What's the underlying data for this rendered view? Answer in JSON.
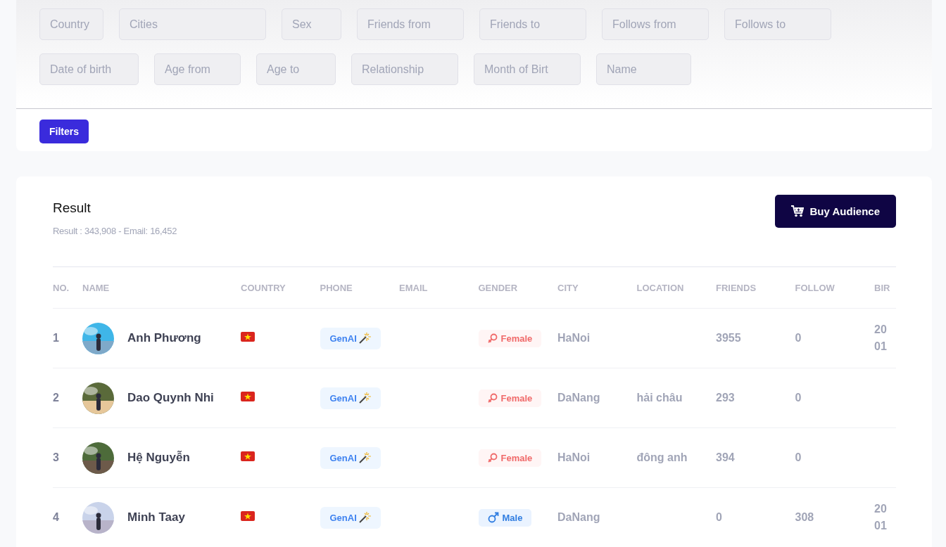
{
  "filters": {
    "fields": [
      {
        "placeholder": "Country"
      },
      {
        "placeholder": "Cities"
      },
      {
        "placeholder": "Sex"
      },
      {
        "placeholder": "Friends from"
      },
      {
        "placeholder": "Friends to"
      },
      {
        "placeholder": "Follows from"
      },
      {
        "placeholder": "Follows to"
      },
      {
        "placeholder": "Date of birth"
      },
      {
        "placeholder": "Age from"
      },
      {
        "placeholder": "Age to"
      },
      {
        "placeholder": "Relationship"
      },
      {
        "placeholder": "Month of Birt"
      },
      {
        "placeholder": "Name"
      }
    ],
    "button": "Filters"
  },
  "result": {
    "title": "Result",
    "summary": "Result : 343,908 - Email: 16,452",
    "buy_button": "Buy Audience",
    "table": {
      "columns": [
        "NO.",
        "NAME",
        "COUNTRY",
        "PHONE",
        "EMAIL",
        "GENDER",
        "CITY",
        "LOCATION",
        "FRIENDS",
        "FOLLOW",
        "BIR"
      ],
      "rows": [
        {
          "no": "1",
          "name": "Anh Phương",
          "phone": "GenAI",
          "gender": {
            "kind": "female",
            "label": "Female"
          },
          "city": "HaNoi",
          "location": "",
          "friends": "3955",
          "follow": "0",
          "birth": [
            "20",
            "01"
          ]
        },
        {
          "no": "2",
          "name": "Dao Quynh Nhi",
          "phone": "GenAI",
          "gender": {
            "kind": "female",
            "label": "Female"
          },
          "city": "DaNang",
          "location": "hải châu",
          "friends": "293",
          "follow": "0",
          "birth": []
        },
        {
          "no": "3",
          "name": "Hệ Nguyễn",
          "phone": "GenAI",
          "gender": {
            "kind": "female",
            "label": "Female"
          },
          "city": "HaNoi",
          "location": "đông anh",
          "friends": "394",
          "follow": "0",
          "birth": []
        },
        {
          "no": "4",
          "name": "Minh Taay",
          "phone": "GenAI",
          "gender": {
            "kind": "male",
            "label": "Male"
          },
          "city": "DaNang",
          "location": "",
          "friends": "0",
          "follow": "308",
          "birth": [
            "20",
            "01"
          ]
        }
      ]
    }
  }
}
